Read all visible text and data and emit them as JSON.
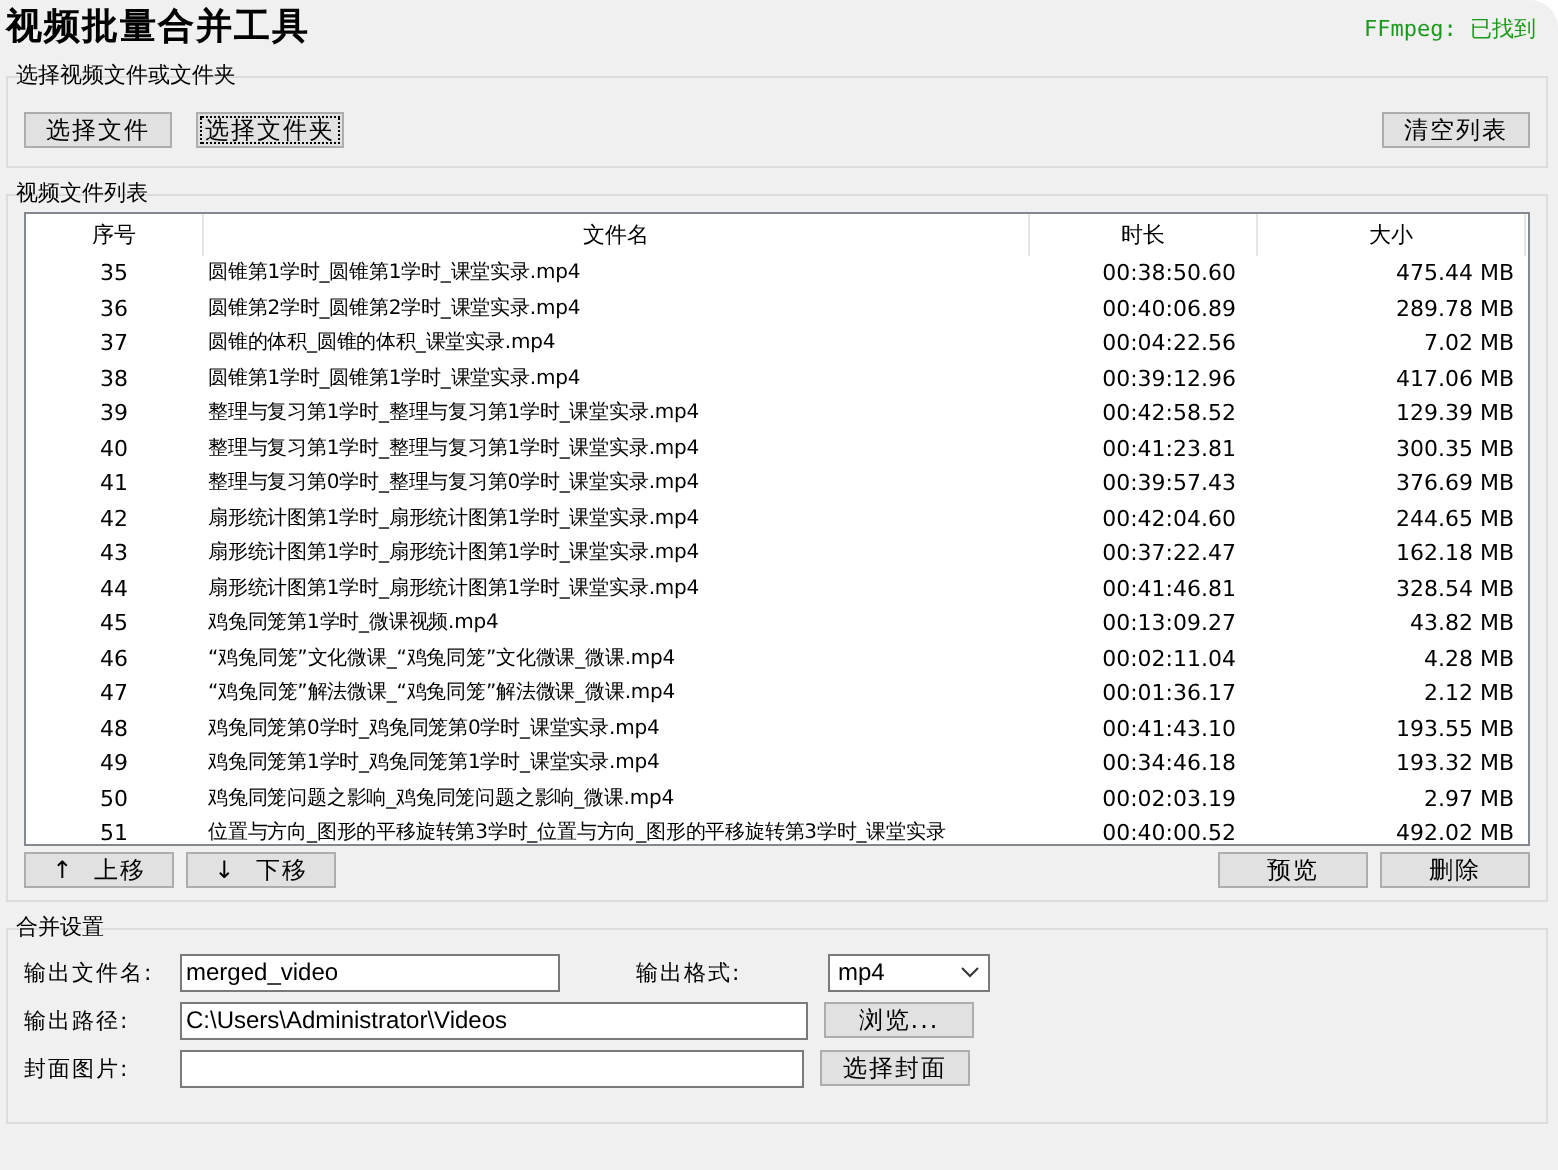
{
  "title": "视频批量合并工具",
  "ffmpeg_status": "FFmpeg: 已找到",
  "file_select": {
    "label": "选择视频文件或文件夹",
    "buttons": [
      {
        "label": "选择文件",
        "focused": false
      },
      {
        "label": "选择文件夹",
        "focused": true
      }
    ],
    "clear_button": "清空列表"
  },
  "file_list": {
    "label": "视频文件列表",
    "columns": [
      "序号",
      "文件名",
      "时长",
      "大小"
    ],
    "rows": [
      {
        "index": "35",
        "name": "圆锥第1学时_圆锥第1学时_课堂实录.mp4",
        "duration": "00:38:50.60",
        "size": "475.44 MB"
      },
      {
        "index": "36",
        "name": "圆锥第2学时_圆锥第2学时_课堂实录.mp4",
        "duration": "00:40:06.89",
        "size": "289.78 MB"
      },
      {
        "index": "37",
        "name": "圆锥的体积_圆锥的体积_课堂实录.mp4",
        "duration": "00:04:22.56",
        "size": "7.02 MB"
      },
      {
        "index": "38",
        "name": "圆锥第1学时_圆锥第1学时_课堂实录.mp4",
        "duration": "00:39:12.96",
        "size": "417.06 MB"
      },
      {
        "index": "39",
        "name": "整理与复习第1学时_整理与复习第1学时_课堂实录.mp4",
        "duration": "00:42:58.52",
        "size": "129.39 MB"
      },
      {
        "index": "40",
        "name": "整理与复习第1学时_整理与复习第1学时_课堂实录.mp4",
        "duration": "00:41:23.81",
        "size": "300.35 MB"
      },
      {
        "index": "41",
        "name": "整理与复习第0学时_整理与复习第0学时_课堂实录.mp4",
        "duration": "00:39:57.43",
        "size": "376.69 MB"
      },
      {
        "index": "42",
        "name": "扇形统计图第1学时_扇形统计图第1学时_课堂实录.mp4",
        "duration": "00:42:04.60",
        "size": "244.65 MB"
      },
      {
        "index": "43",
        "name": "扇形统计图第1学时_扇形统计图第1学时_课堂实录.mp4",
        "duration": "00:37:22.47",
        "size": "162.18 MB"
      },
      {
        "index": "44",
        "name": "扇形统计图第1学时_扇形统计图第1学时_课堂实录.mp4",
        "duration": "00:41:46.81",
        "size": "328.54 MB"
      },
      {
        "index": "45",
        "name": "鸡兔同笼第1学时_微课视频.mp4",
        "duration": "00:13:09.27",
        "size": "43.82 MB"
      },
      {
        "index": "46",
        "name": "“鸡兔同笼”文化微课_“鸡兔同笼”文化微课_微课.mp4",
        "duration": "00:02:11.04",
        "size": "4.28 MB"
      },
      {
        "index": "47",
        "name": "“鸡兔同笼”解法微课_“鸡兔同笼”解法微课_微课.mp4",
        "duration": "00:01:36.17",
        "size": "2.12 MB"
      },
      {
        "index": "48",
        "name": "鸡兔同笼第0学时_鸡兔同笼第0学时_课堂实录.mp4",
        "duration": "00:41:43.10",
        "size": "193.55 MB"
      },
      {
        "index": "49",
        "name": "鸡兔同笼第1学时_鸡兔同笼第1学时_课堂实录.mp4",
        "duration": "00:34:46.18",
        "size": "193.32 MB"
      },
      {
        "index": "50",
        "name": "鸡兔同笼问题之影响_鸡兔同笼问题之影响_微课.mp4",
        "duration": "00:02:03.19",
        "size": "2.97 MB"
      },
      {
        "index": "51",
        "name": "位置与方向_图形的平移旋转第3学时_位置与方向_图形的平移旋转第3学时_课堂实录",
        "duration": "00:40:00.52",
        "size": "492.02 MB"
      }
    ],
    "move_up_button": {
      "arrow": "↑",
      "label": "上移"
    },
    "move_down_button": {
      "arrow": "↓",
      "label": "下移"
    },
    "preview_button": "预览",
    "delete_button": "删除"
  },
  "merge_settings": {
    "label": "合并设置",
    "output_name_label": "输出文件名:",
    "output_name": "merged_video",
    "format_label": "输出格式:",
    "format": "mp4",
    "output_path_label": "输出路径:",
    "output_path": "C:\\Users\\Administrator\\Videos",
    "browse_button": "浏览...",
    "cover_label": "封面图片:",
    "cover_button": "选择封面"
  }
}
